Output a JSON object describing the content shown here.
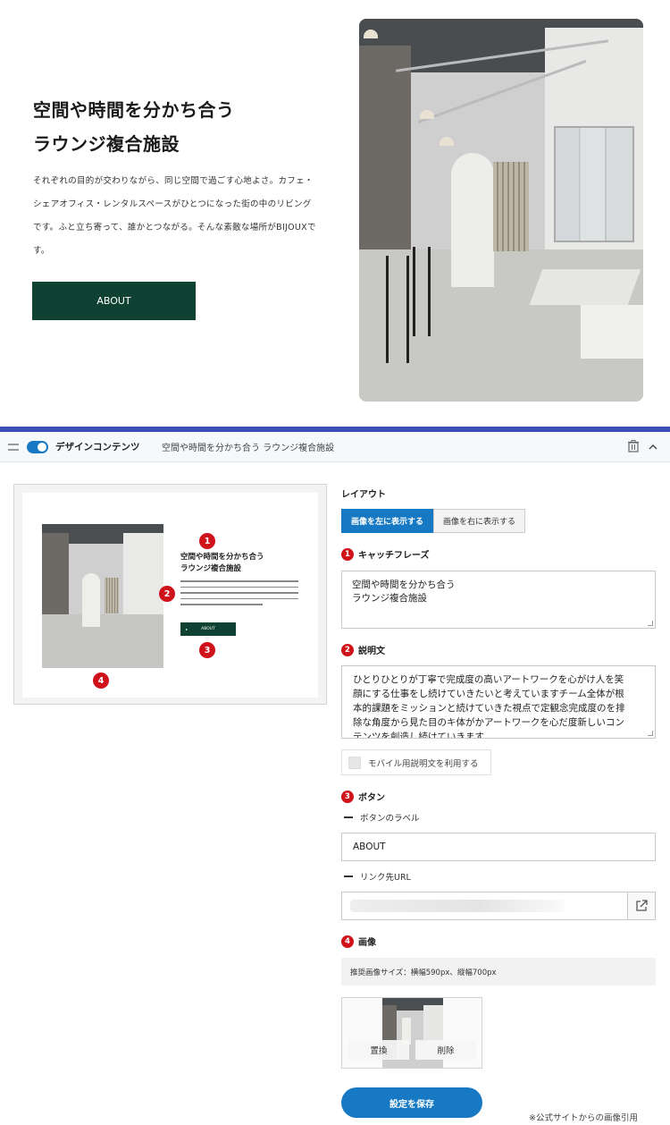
{
  "hero": {
    "title_lines": [
      "空間や時間を分かち合う",
      "ラウンジ複合施設"
    ],
    "description_lines": [
      "それぞれの目的が交わりながら、同じ空間で過ごす心地よさ。カフェ・",
      "シェアオフィス・レンタルスペースがひとつになった街の中のリビング",
      "です。ふと立ち寄って、誰かとつながる。そんな素敵な場所がBIJOUXで",
      "す。"
    ],
    "button_label": "ABOUT",
    "button_color": "#0f4232"
  },
  "editor": {
    "block_title": "デザインコンテンツ",
    "block_subtitle": "空間や時間を分かち合う ラウンジ複合施設",
    "accent_color": "#1779c4",
    "icons": [
      "drag-handle-icon",
      "toggle-switch",
      "trash-icon",
      "chevron-up-icon"
    ]
  },
  "preview": {
    "title_lines": [
      "空間や時間を分かち合う",
      "ラウンジ複合施設"
    ],
    "button_label": "ABOUT",
    "badges": [
      "1",
      "2",
      "3",
      "4"
    ]
  },
  "settings": {
    "layout_label": "レイアウト",
    "layout_options": [
      "画像を左に表示する",
      "画像を右に表示する"
    ],
    "layout_selected": "画像を左に表示する",
    "catchphrase": {
      "number": "1",
      "label": "キャッチフレーズ",
      "lines": [
        "空間や時間を分かち合う",
        "ラウンジ複合施設"
      ]
    },
    "description": {
      "number": "2",
      "label": "説明文",
      "lines": [
        "ひとりひとりが丁寧で完成度の高いアートワークを心がけ人を笑",
        "顔にする仕事をし続けていきたいと考えていますチーム全体が根",
        "本的課題をミッションと続けていきた視点で定観念完成度のを排",
        "除な角度から見た目のキ体がかアートワークを心だ度新しいコン",
        "テンツを創造し続けていきます"
      ]
    },
    "mobile_checkbox_label": "モバイル用説明文を利用する",
    "button": {
      "number": "3",
      "label": "ボタン",
      "label_field_title": "ボタンのラベル",
      "label_value": "ABOUT",
      "url_field_title": "リンク先URL"
    },
    "image": {
      "number": "4",
      "label": "画像",
      "hint": "推奨画像サイズ：横幅590px、縦幅700px",
      "replace_label": "置換",
      "delete_label": "削除"
    },
    "save_label": "設定を保存"
  },
  "caption": "※公式サイトからの画像引用"
}
